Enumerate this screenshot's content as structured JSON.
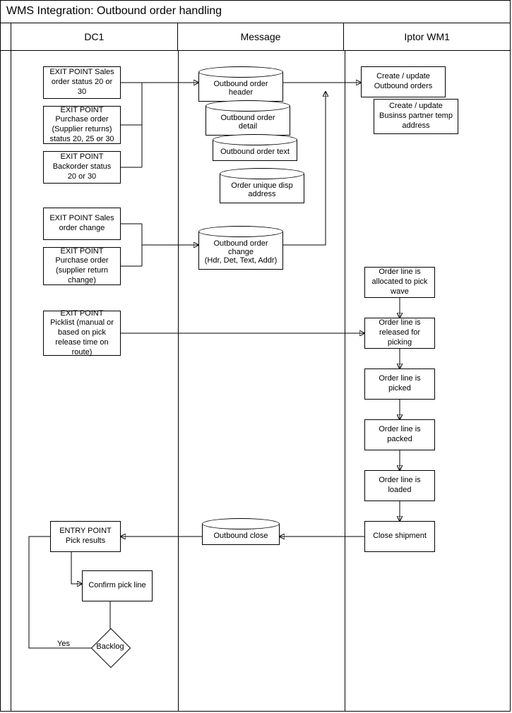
{
  "title": "WMS Integration: Outbound order handling",
  "lanes": [
    "DC1",
    "Message",
    "Iptor WM1"
  ],
  "dc1": {
    "ep1": "EXIT POINT\nSales order status 20 or 30",
    "ep2": "EXIT POINT\nPurchase order (Supplier returns) status 20, 25 or 30",
    "ep3": "EXIT POINT\nBackorder status 20 or 30",
    "ep4": "EXIT POINT\nSales order change",
    "ep5": "EXIT POINT\nPurchase order (supplier return change)",
    "ep6": "EXIT POINT\nPicklist (manual or based on pick release time on route)",
    "entry": "ENTRY POINT\nPick results",
    "confirm": "Confirm pick line",
    "backlog": "Backlog",
    "yes": "Yes"
  },
  "msg": {
    "m1": "Outbound order header",
    "m2": "Outbound order detail",
    "m3": "Outbound order text",
    "m4": "Order unique disp address",
    "m5": "Outbound order change\n(Hdr, Det, Text, Addr)",
    "m6": "Outbound close"
  },
  "wm1": {
    "create1": "Create / update Outbound orders",
    "create2": "Create / update Businss partner temp address",
    "s1": "Order line is allocated to pick wave",
    "s2": "Order line is released for picking",
    "s3": "Order line is picked",
    "s4": "Order line is packed",
    "s5": "Order line is loaded",
    "s6": "Close shipment"
  }
}
